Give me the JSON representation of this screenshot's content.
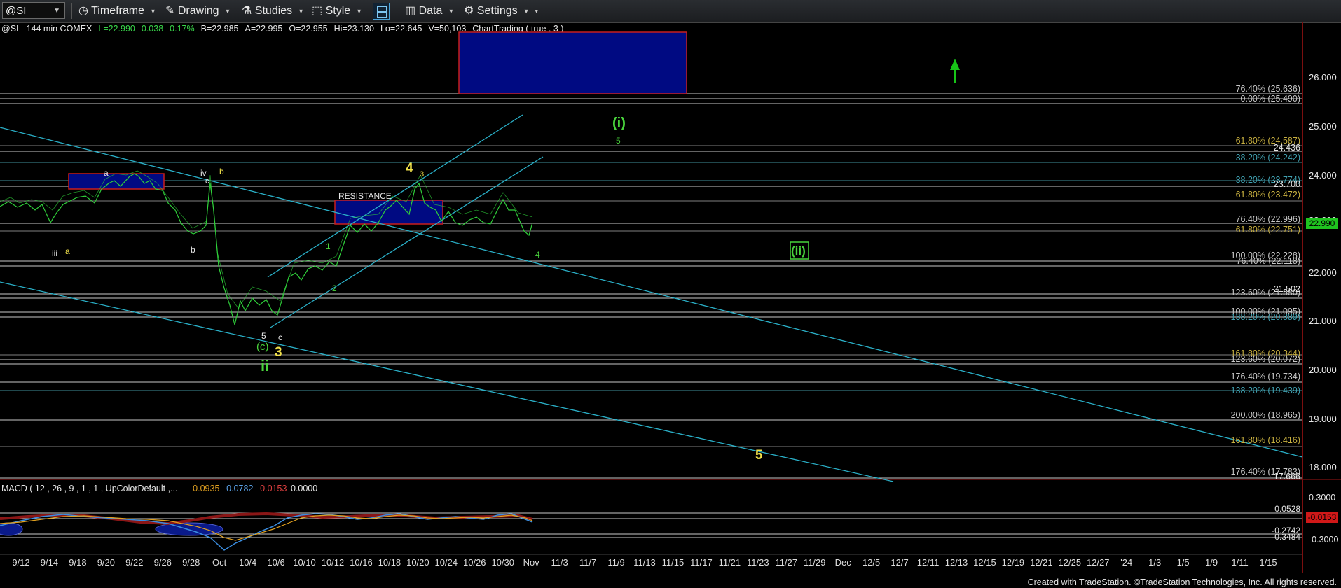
{
  "toolbar": {
    "symbol": "@SI",
    "timeframe": "Timeframe",
    "drawing": "Drawing",
    "studies": "Studies",
    "style": "Style",
    "data": "Data",
    "settings": "Settings"
  },
  "quote": {
    "instrument": "@SI - 144 min  COMEX",
    "last": "L=22.990",
    "change": "0.038",
    "change_pct": "0.17%",
    "bid": "B=22.985",
    "ask": "A=22.995",
    "open": "O=22.955",
    "high": "Hi=23.130",
    "low": "Lo=22.645",
    "volume": "V=50,103",
    "study": "ChartTrading ( true , 3 )"
  },
  "price_axis": [
    "26.000",
    "25.000",
    "24.000",
    "23.000",
    "22.000",
    "21.000",
    "20.000",
    "19.000",
    "18.000"
  ],
  "last_price_tag": "22.990",
  "macd": {
    "header": "MACD ( 12 , 26 , 9 , 1 , 1 , UpColorDefault ,...",
    "v1": "-0.0935",
    "v2": "-0.0782",
    "v3": "-0.0153",
    "v4": "0.0000",
    "axis": [
      "0.3000",
      "0.0528",
      "-0.2742",
      "-0.3484",
      "-0.3000"
    ],
    "tag": "-0.0153"
  },
  "fib_levels": [
    "76.40% (25.636)",
    "0.00% (25.490)",
    "61.80% (24.587)",
    "24.436",
    "38.20% (24.242)",
    "38.20% (23.774)",
    "23.700",
    "61.80% (23.472)",
    "76.40% (22.996)",
    "61.80% (22.751)",
    "100.00% (22.228)",
    "76.40% (22.118)",
    "123.60% (21.580)",
    "21.502",
    "100.00% (21.095)",
    "138.20% (20.889)",
    "161.80% (20.344)",
    "123.60% (20.072)",
    "176.40% (19.734)",
    "138.20% (19.439)",
    "200.00% (18.965)",
    "161.80% (18.416)",
    "176.40% (17.783)",
    "17.666"
  ],
  "annotations": {
    "resistance": "RESISTANCE",
    "wave_i_paren": "(i)",
    "wave_5_green_top": "5",
    "wave_ii_box": "(ii)",
    "wave_4_yellow": "4",
    "wave_3_small": "3",
    "wave_4_green": "4",
    "wave_5_yellow_low": "5",
    "wave_ii_green": "ii",
    "wave_3_yellow": "3",
    "wave_c_green": "(c)",
    "wave_5_small": "5",
    "wave_c_small": "c",
    "wave_1": "1",
    "wave_2": "2",
    "wave_a_top": "a",
    "wave_iv": "iv",
    "wave_c_top": "c",
    "wave_b_top": "b",
    "wave_iii": "iii",
    "wave_a_low": "a",
    "wave_b_low": "b"
  },
  "dates": [
    "9/12",
    "9/14",
    "9/18",
    "9/20",
    "9/22",
    "9/26",
    "9/28",
    "Oct",
    "10/4",
    "10/6",
    "10/10",
    "10/12",
    "10/16",
    "10/18",
    "10/20",
    "10/24",
    "10/26",
    "10/30",
    "Nov",
    "11/3",
    "11/7",
    "11/9",
    "11/13",
    "11/15",
    "11/17",
    "11/21",
    "11/23",
    "11/27",
    "11/29",
    "Dec",
    "12/5",
    "12/7",
    "12/11",
    "12/13",
    "12/15",
    "12/19",
    "12/21",
    "12/25",
    "12/27",
    "'24",
    "1/3",
    "1/5",
    "1/9",
    "1/11",
    "1/15"
  ],
  "footer": "Created with TradeStation. ©TradeStation Technologies, Inc. All rights reserved.",
  "colors": {
    "up_arrow": "#18c418",
    "box_fill": "#000a82",
    "box_border": "#c81e1e",
    "trendline": "#2ab0c8",
    "price_tag": "#1fc31f",
    "macd_tag": "#d01818"
  }
}
